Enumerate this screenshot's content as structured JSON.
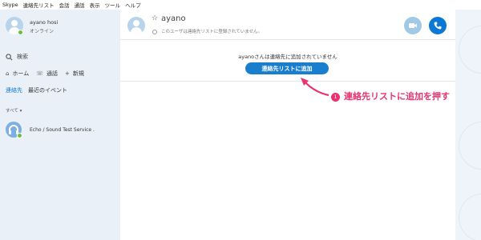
{
  "menu": [
    "Skype",
    "連絡先リスト",
    "会話",
    "通話",
    "表示",
    "ツール",
    "ヘルプ"
  ],
  "profile": {
    "name": "ayano hosi",
    "status": "オンライン"
  },
  "search": {
    "label": "検索"
  },
  "nav": {
    "home": "ホーム",
    "call": "通話",
    "new": "新規"
  },
  "tabs": [
    "連絡先",
    "最近のイベント"
  ],
  "filter": "すべて ▾",
  "contacts": [
    {
      "name": "Echo / Sound Test Service ."
    }
  ],
  "chat": {
    "name": "ayano",
    "subtitle": "このユーザは連絡先リストに登録されていません。",
    "notice": "ayanoさんは連絡先に追加されていません",
    "add_button": "連絡先リストに追加"
  },
  "annotation": {
    "number": "1",
    "text": "連絡先リストに追加を押す"
  },
  "colors": {
    "accent": "#0a78d4",
    "annotation": "#e8336f",
    "presence": "#6bbf3d"
  },
  "icons": {
    "home": "house-icon",
    "call": "phone-icon",
    "new": "plus-icon"
  }
}
